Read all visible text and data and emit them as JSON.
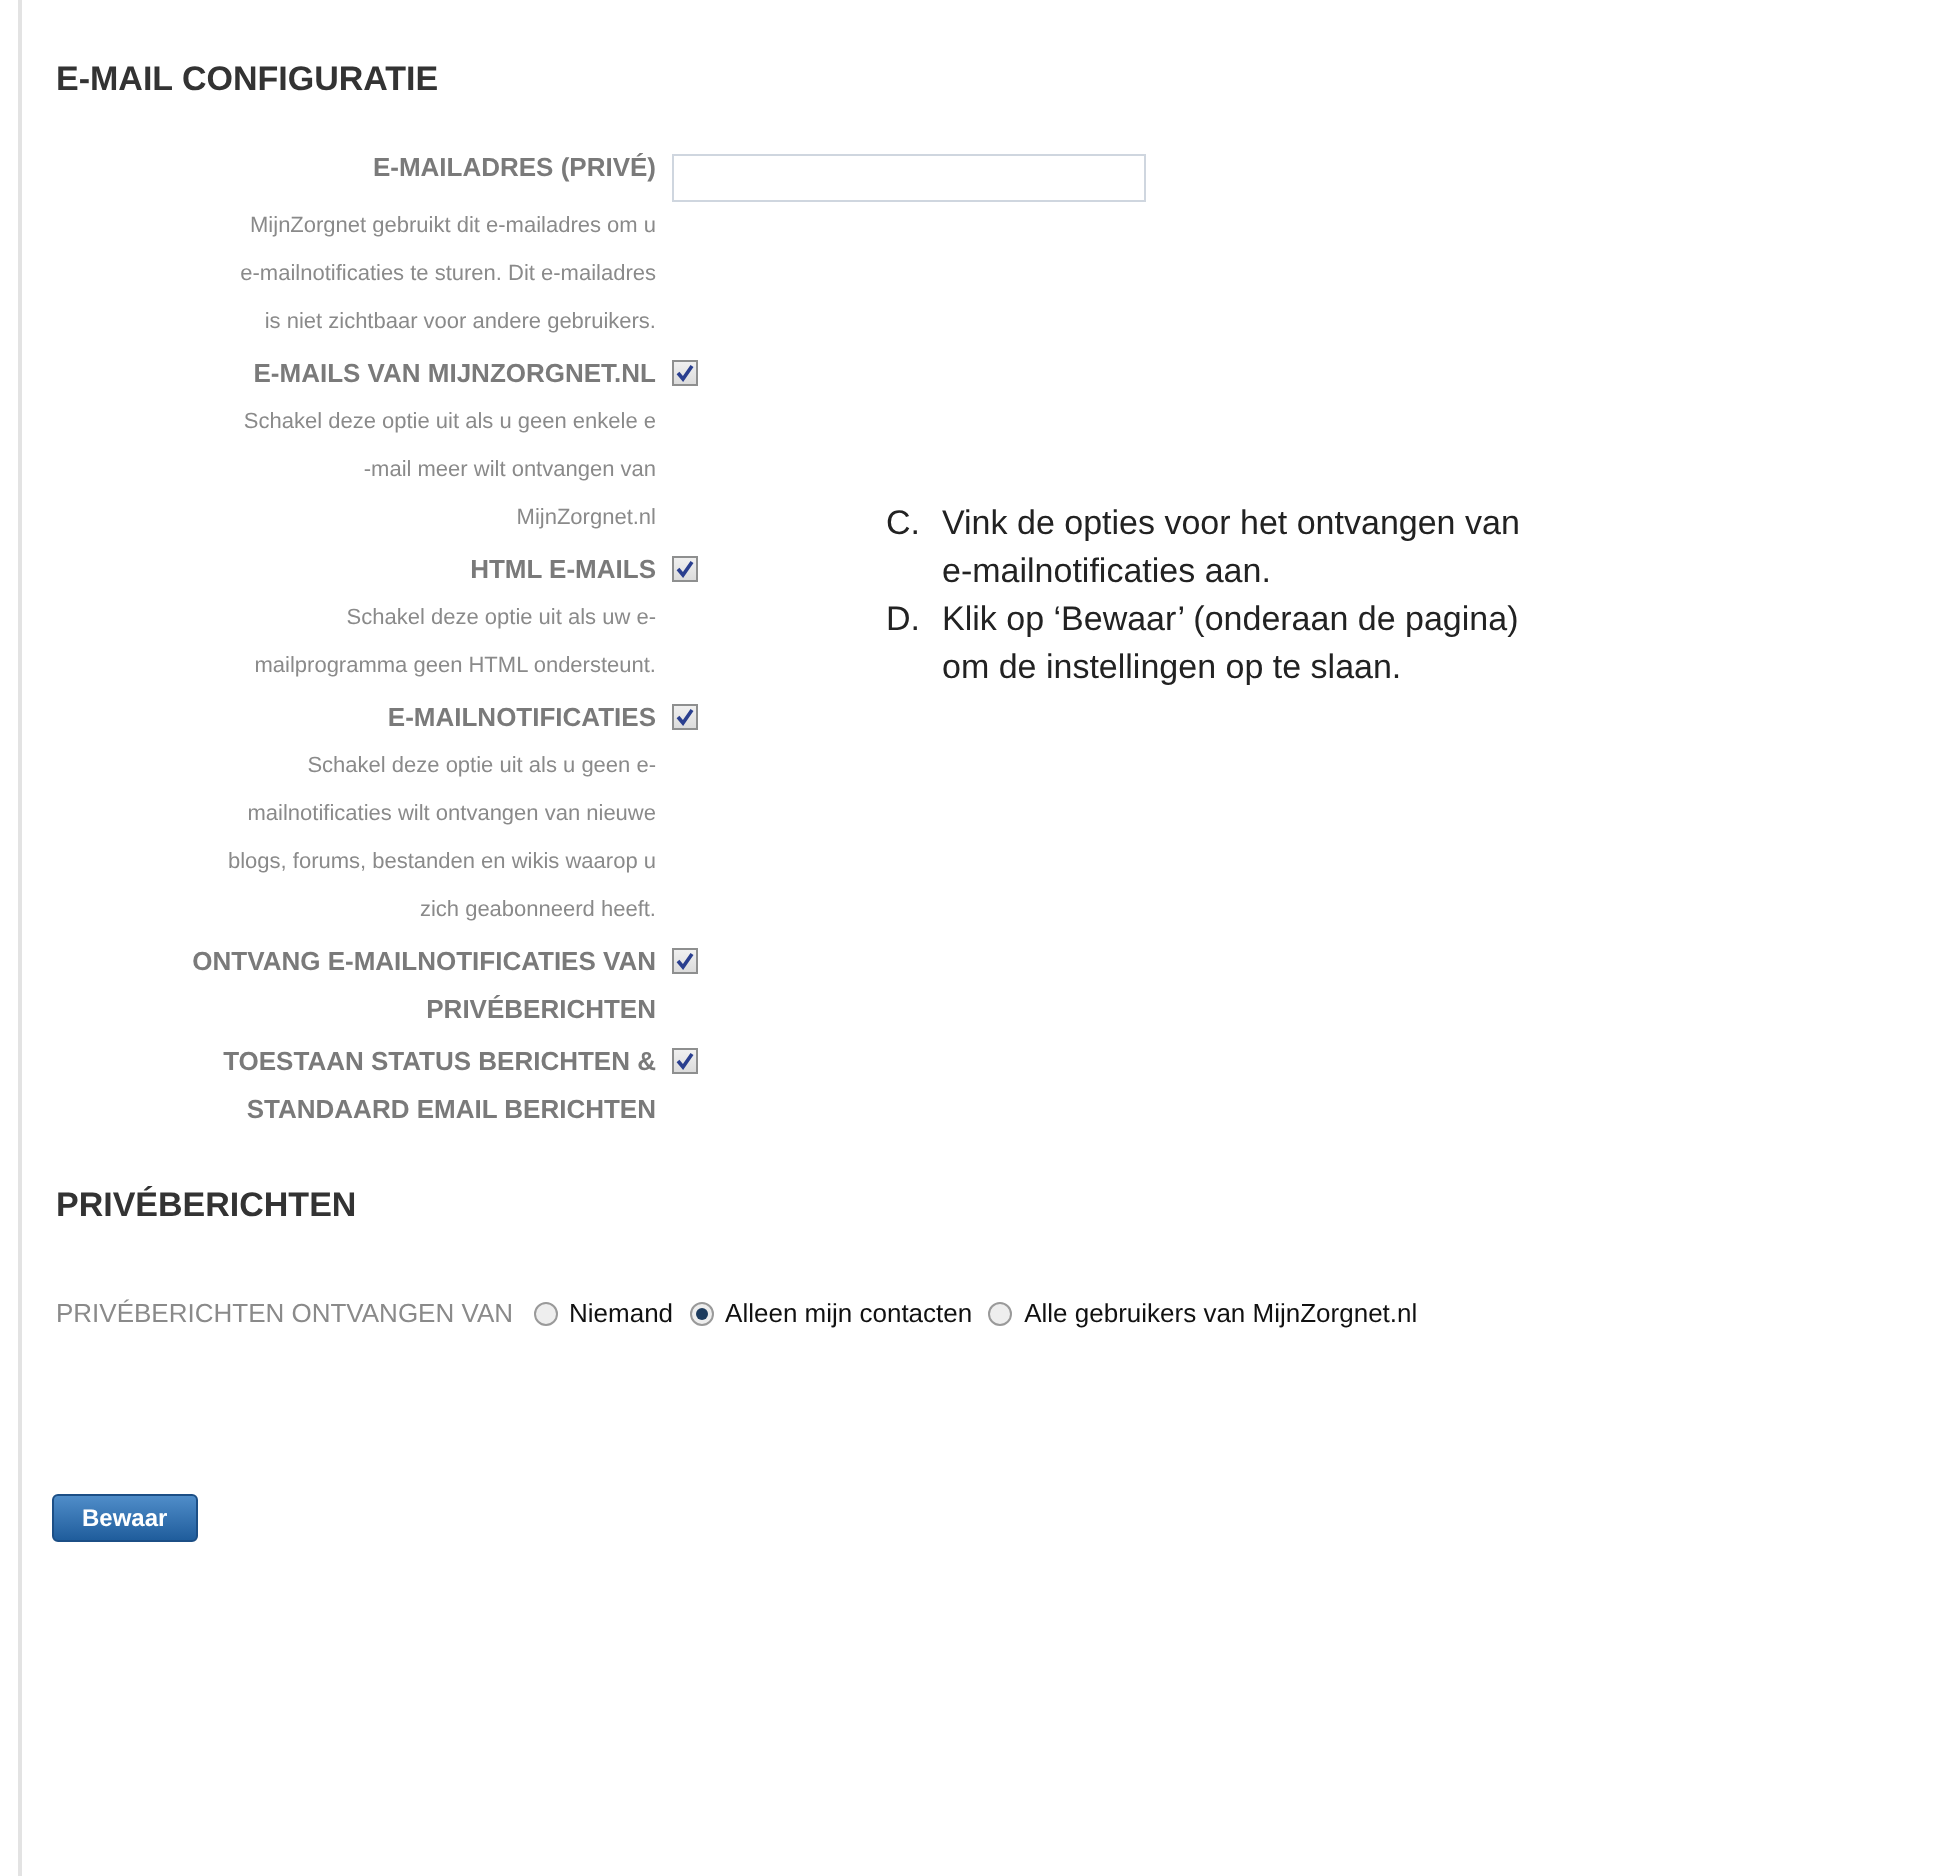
{
  "email_section": {
    "title": "E-MAIL CONFIGURATIE",
    "settings": [
      {
        "kind": "text-field",
        "label": "E-MAILADRES (PRIVÉ)",
        "description": [
          "MijnZorgnet gebruikt dit e-mailadres om u",
          "e-mailnotificaties te sturen. Dit e-mailadres",
          "is niet zichtbaar voor andere gebruikers."
        ]
      },
      {
        "kind": "checkbox",
        "label": "E-MAILS VAN MIJNZORGNET.NL",
        "checked": true,
        "description": [
          "Schakel deze optie uit als u geen enkele e",
          "-mail meer wilt ontvangen van",
          "MijnZorgnet.nl"
        ]
      },
      {
        "kind": "checkbox",
        "label": "HTML E-MAILS",
        "checked": true,
        "description": [
          "Schakel deze optie uit als uw e-",
          "mailprogramma geen HTML ondersteunt."
        ]
      },
      {
        "kind": "checkbox",
        "label": "E-MAILNOTIFICATIES",
        "checked": true,
        "description": [
          "Schakel deze optie uit als u geen e-",
          "mailnotificaties wilt ontvangen van nieuwe",
          "blogs, forums, bestanden en wikis waarop u",
          "zich geabonneerd heeft."
        ]
      },
      {
        "kind": "checkbox",
        "label": "ONTVANG E-MAILNOTIFICATIES VAN PRIVÉBERICHTEN",
        "checked": true
      },
      {
        "kind": "checkbox",
        "label": "TOESTAAN STATUS BERICHTEN & STANDAARD EMAIL BERICHTEN",
        "checked": true
      }
    ]
  },
  "instructions": [
    {
      "marker": "C.",
      "text": "Vink de opties voor het ontvangen van e-mailnotificaties aan."
    },
    {
      "marker": "D.",
      "text": "Klik op ‘Bewaar’ (onderaan de pagina) om de instellingen op te slaan."
    }
  ],
  "private_section": {
    "title": "PRIVÉBERICHTEN",
    "label": "PRIVÉBERICHTEN ONTVANGEN VAN",
    "options": [
      {
        "label": "Niemand",
        "selected": false
      },
      {
        "label": "Alleen mijn contacten",
        "selected": true
      },
      {
        "label": "Alle gebruikers van MijnZorgnet.nl",
        "selected": false
      }
    ]
  },
  "save_button": "Bewaar"
}
